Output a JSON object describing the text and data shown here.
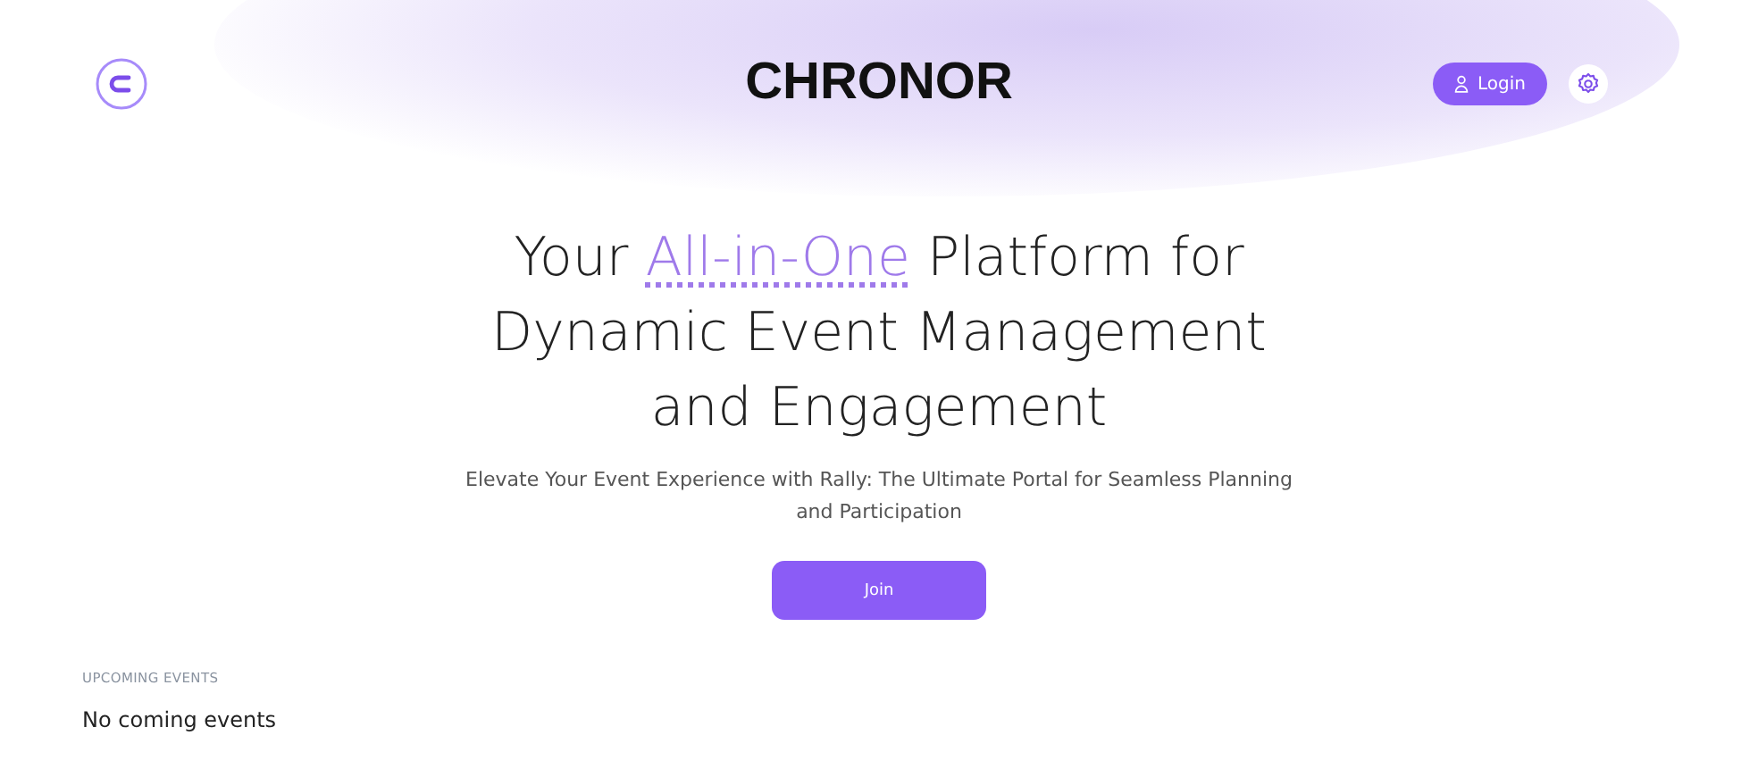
{
  "header": {
    "title": "CHRONOR",
    "login_button": "Login"
  },
  "hero": {
    "headline": {
      "before": "Your ",
      "highlight": "All-in-One",
      "after": " Platform for Dynamic Event Management and Engagement"
    },
    "subtitle": "Elevate Your Event Experience with Rally: The Ultimate Portal for Seamless Planning and Participation",
    "join_button": "Join"
  },
  "sections": [
    {
      "heading": "UPCOMING EVENTS",
      "message": "No coming events"
    }
  ]
}
